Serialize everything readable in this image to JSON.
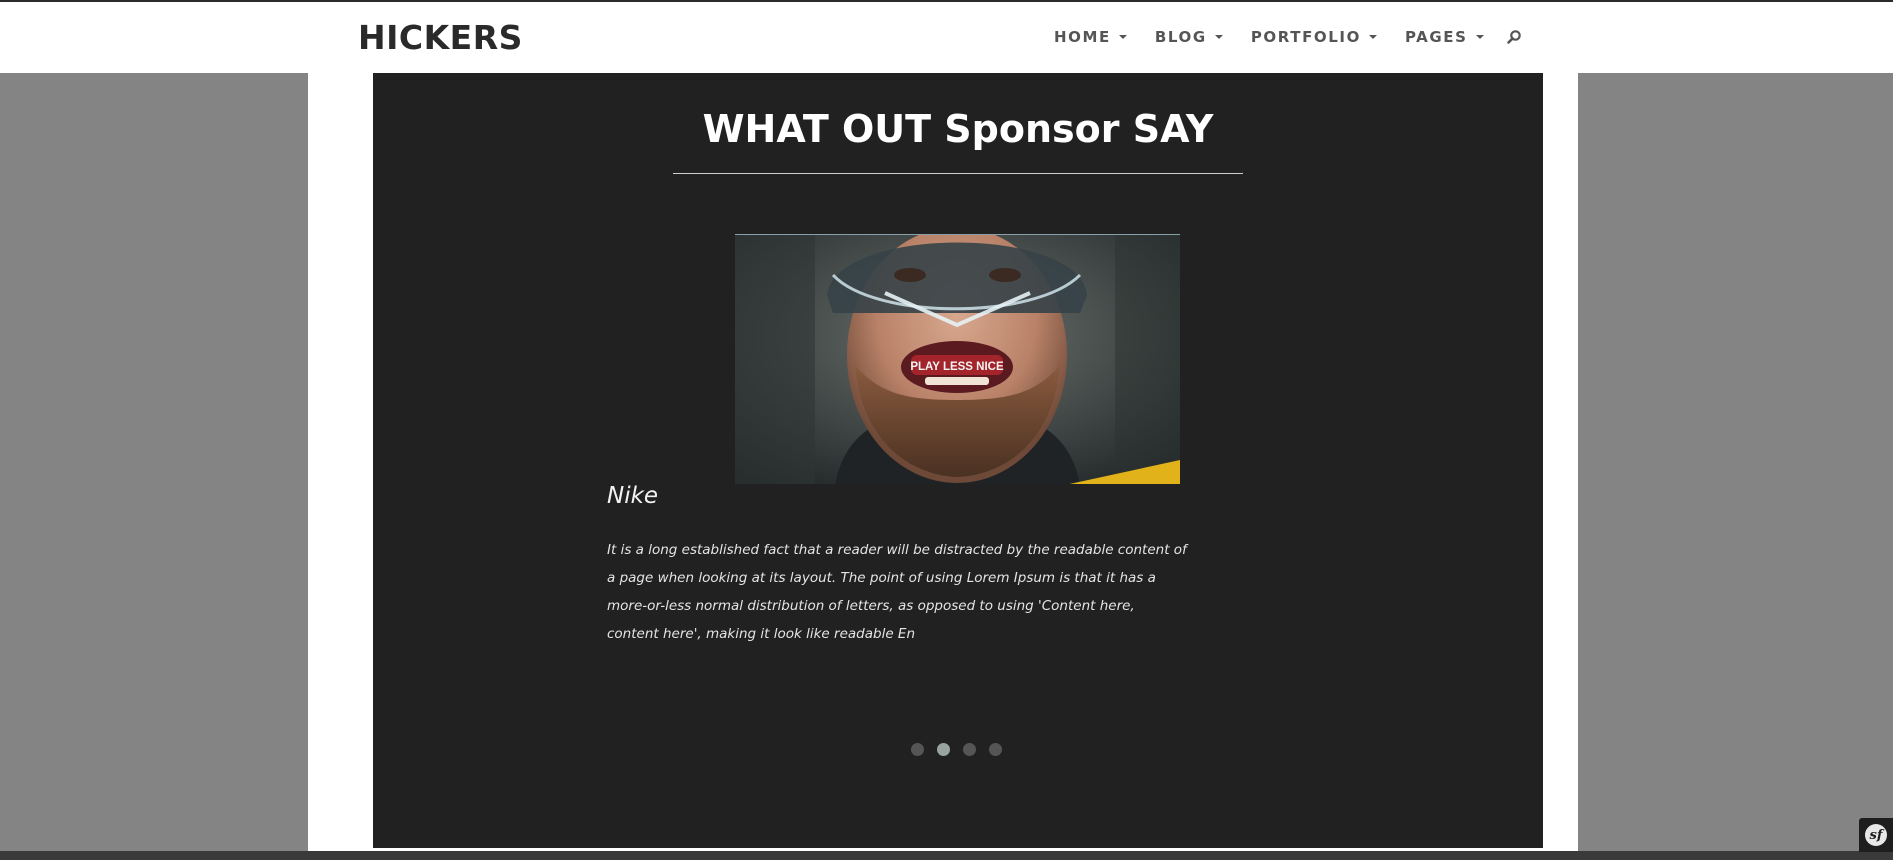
{
  "brand": "HICKERS",
  "nav": {
    "items": [
      {
        "label": "HOME"
      },
      {
        "label": "BLOG"
      },
      {
        "label": "PORTFOLIO"
      },
      {
        "label": "PAGES"
      }
    ],
    "search_icon": "search-icon"
  },
  "testimonial": {
    "title": "WHAT OUT Sponsor SAY",
    "image_caption": "PLAY LESS NICE",
    "sponsor": "Nike",
    "text": "It is a long established fact that a reader will be distracted by the readable content of a page when looking at its layout. The point of using Lorem Ipsum is that it has a more-or-less normal distribution of letters, as opposed to using 'Content here, content here', making it look like readable En",
    "active_slide": 2,
    "slide_count": 4
  },
  "debug_toolbar": {
    "icon": "symfony-icon",
    "glyph": "sf"
  },
  "colors": {
    "panel": "#212121",
    "background": "#848484",
    "brand_text": "#2a2a2a",
    "nav_text": "#555555",
    "dot_active": "#9aa2a2",
    "dot_inactive": "#555555"
  }
}
